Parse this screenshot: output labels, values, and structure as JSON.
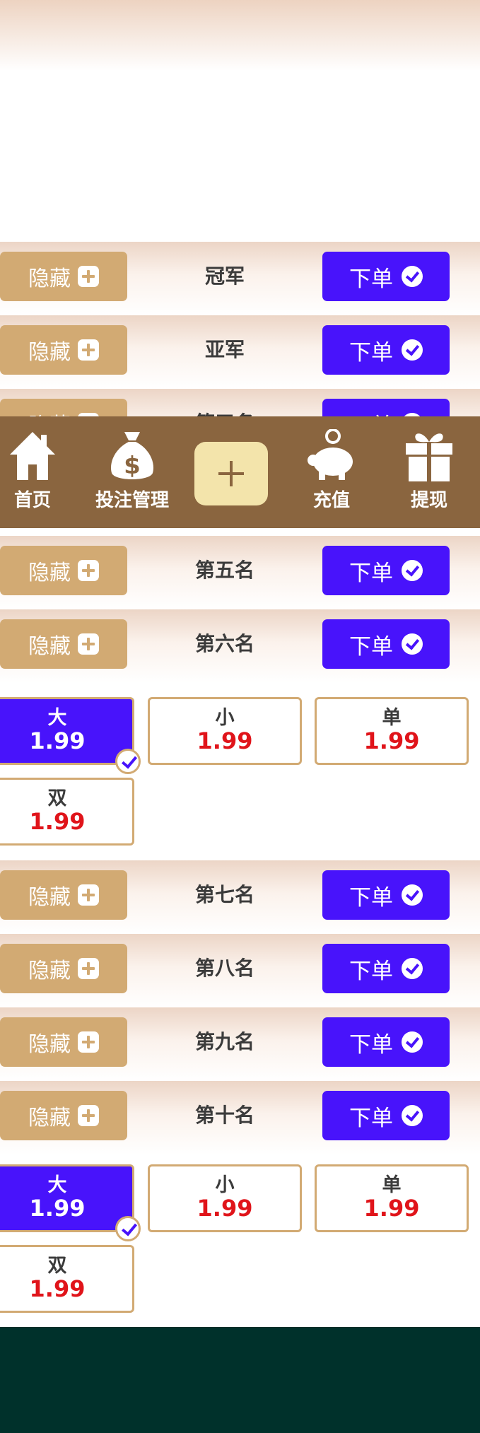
{
  "rows": {
    "hide_label": "隐藏",
    "order_label": "下单",
    "r1": "冠军",
    "r2": "亚军",
    "r3": "第三名",
    "r5": "第五名",
    "r6": "第六名",
    "r7": "第七名",
    "r8": "第八名",
    "r9": "第九名",
    "r10": "第十名"
  },
  "options": {
    "big": "大",
    "small": "小",
    "odd": "单",
    "even": "双",
    "rate": "1.99",
    "selected": "大"
  },
  "tabbar": {
    "home": "首页",
    "bets": "投注管理",
    "recharge": "充值",
    "withdraw": "提现"
  },
  "colors": {
    "accent": "#4813fb",
    "gold": "#d2aa73",
    "bar": "#8a653f",
    "odds": "#e0141a",
    "footer": "#00312b"
  }
}
